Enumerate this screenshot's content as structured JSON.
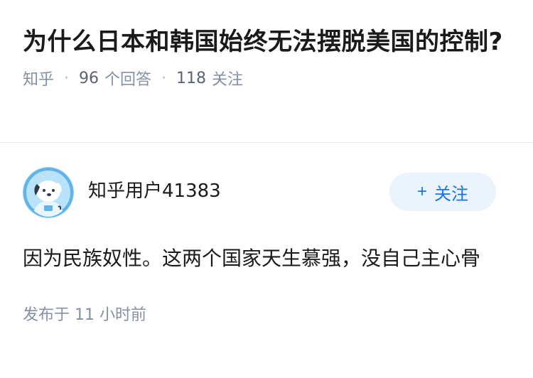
{
  "question": {
    "title": "为什么日本和韩国始终无法摆脱美国的控制?",
    "source": "知乎",
    "answers_count": "96",
    "answers_label": "个回答",
    "followers_count": "118",
    "followers_label": "关注"
  },
  "answer": {
    "author_name": "知乎用户41383",
    "follow_label": "关注",
    "content": "因为民族奴性。这两个国家天生慕强，没自己主心骨",
    "published": "发布于 11 小时前"
  },
  "icons": {
    "avatar": "astronaut-dog-avatar",
    "follow": "plus-icon"
  },
  "colors": {
    "accent": "#1772f6",
    "follow_bg": "#ebf3fc",
    "meta_text": "#8590a6"
  }
}
